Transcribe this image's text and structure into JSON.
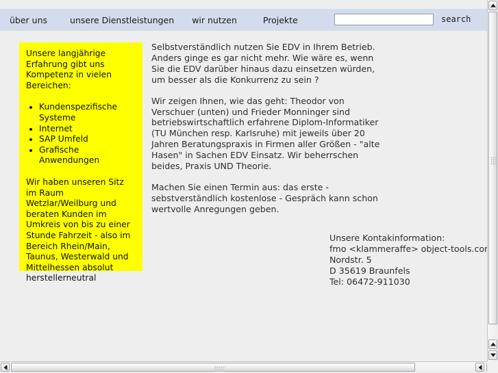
{
  "colors": {
    "page_background": "#eeeeee",
    "navbar_background": "#d2dcec",
    "highlight_box_background": "#ffff00",
    "body_text": "#2e2e2e"
  },
  "navbar": {
    "links": [
      {
        "label": "über uns"
      },
      {
        "label": "unsere Dienstleistungen"
      },
      {
        "label": "wir nutzen"
      },
      {
        "label": "Projekte"
      }
    ],
    "search": {
      "value": "",
      "placeholder": "",
      "button_label": "search"
    }
  },
  "sidebar": {
    "intro": "Unsere langjährige Erfahrung gibt uns Kompetenz in vielen Bereichen:",
    "items": [
      {
        "label": "Kundenspezifische Systeme"
      },
      {
        "label": "Internet"
      },
      {
        "label": "SAP Umfeld"
      },
      {
        "label": "Grafische Anwendungen"
      }
    ],
    "outro": "Wir haben unseren Sitz im Raum Wetzlar/Weilburg und beraten Kunden im Umkreis von bis zu einer Stunde Fahrzeit - also im Bereich Rhein/Main, Taunus, Westerwald und Mittelhessen absolut herstellerneutral"
  },
  "main": {
    "paragraphs": [
      "Selbstverständlich nutzen Sie EDV in Ihrem Betrieb. Anders ginge es gar nicht mehr. Wie wäre es, wenn Sie die EDV darüber hinaus dazu einsetzen würden, um besser als die Konkurrenz zu sein ?",
      "Wir zeigen Ihnen, wie das geht: Theodor von Verschuer (unten) und Frieder Monninger sind betriebswirtschaftlich erfahrene Diplom-Informatiker (TU München resp. Karlsruhe) mit jeweils über 20 Jahren Beratungspraxis in Firmen aller Größen - \"alte Hasen\" in Sachen EDV Einsatz. Wir beherrschen beides, Praxis UND Theorie.",
      "Machen Sie einen Termin aus: das  erste - sebstverständlich kostenlose - Gespräch kann schon wertvolle Anregungen geben."
    ]
  },
  "contact": {
    "heading": "Unsere Kontakinformation:",
    "email": "fmo <klammeraffe> object-tools.com",
    "street": "Nordstr. 5",
    "city": "D 35619 Braunfels",
    "phone": "Tel: 06472-911030"
  },
  "scrollbars": {
    "vertical": {
      "arrow_up": "▲",
      "arrow_down": "▼"
    },
    "horizontal": {
      "arrow_left": "◀",
      "arrow_right": "▶"
    }
  }
}
